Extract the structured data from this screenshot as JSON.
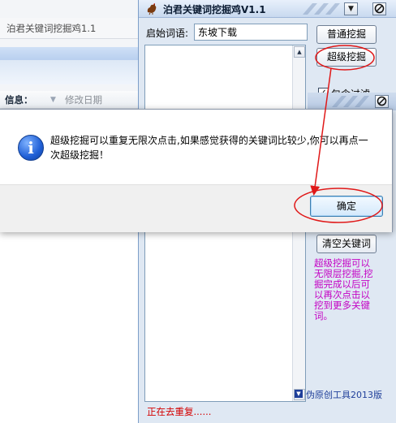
{
  "background_window": {
    "title": "泊君关键词挖掘鸡1.1",
    "column_label": "信息：",
    "column_header": "修改日期"
  },
  "app": {
    "title": "泊君关键词挖掘鸡V1.1",
    "seed_label": "启始词语:",
    "seed_value": "东坡下载",
    "normal_button": "普通挖掘",
    "super_button": "超级挖掘",
    "filter_label": "包含过滤",
    "filter_checked": true,
    "clear_button": "清空关键词",
    "tip_text": "超级挖掘可以无限层挖掘,挖掘完成以后可以再次点击以挖到更多关键词。",
    "promo_text": "伪原创工具2013版",
    "status_text": "正在去重复......"
  },
  "dialog": {
    "message": "超级挖掘可以重复无限次点击,如果感觉获得的关键词比较少,你可以再点一次超级挖掘！",
    "ok_label": "确定"
  },
  "icons": {
    "app_logo": "rooster-icon",
    "dialog_icon": "info-icon"
  },
  "colors": {
    "annotation_red": "#e01818",
    "tip_magenta": "#c400c4",
    "status_red": "#d40000"
  }
}
